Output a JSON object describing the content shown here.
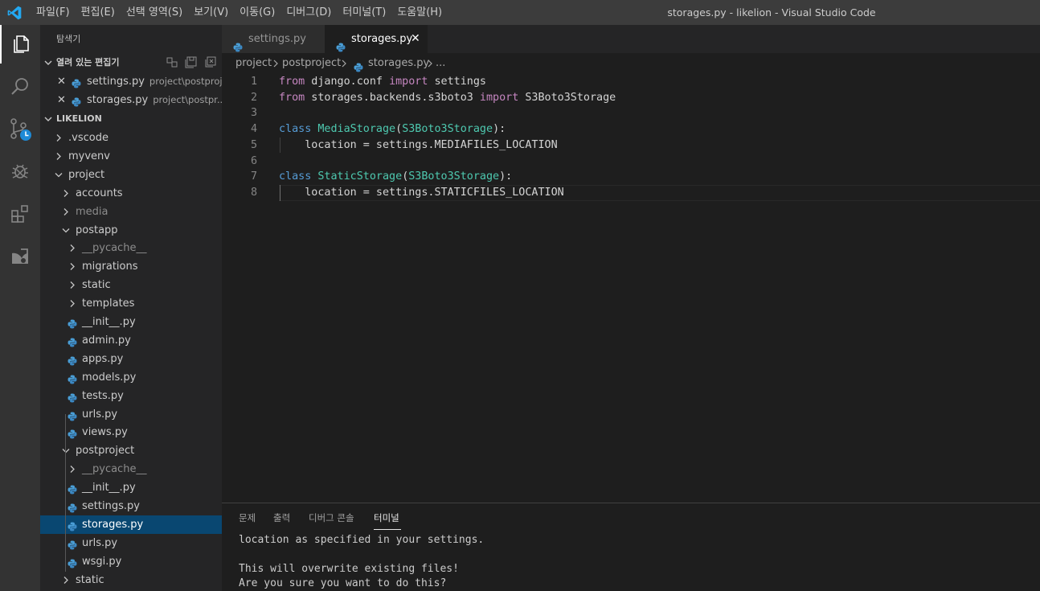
{
  "menu": [
    "파일(F)",
    "편집(E)",
    "선택 영역(S)",
    "보기(V)",
    "이동(G)",
    "디버그(D)",
    "터미널(T)",
    "도움말(H)"
  ],
  "window_title": "storages.py - likelion - Visual Studio Code",
  "activity_icons": [
    "explorer-icon",
    "search-icon",
    "source-control-icon",
    "debug-icon",
    "extensions-icon",
    "remote-icon"
  ],
  "sidebar": {
    "title": "탐색기",
    "open_editors_header": "열려 있는 편집기",
    "open_editors": [
      {
        "name": "settings.py",
        "path": "project\\postproj..."
      },
      {
        "name": "storages.py",
        "path": "project\\postpr..."
      }
    ],
    "workspace_header": "LIKELION",
    "tree": [
      {
        "label": "vscode_",
        "text": ".vscode",
        "kind": "folder",
        "state": "collapsed",
        "depth": 1
      },
      {
        "text": "myvenv",
        "kind": "folder",
        "state": "collapsed",
        "depth": 1
      },
      {
        "text": "project",
        "kind": "folder",
        "state": "expanded",
        "depth": 1
      },
      {
        "text": "accounts",
        "kind": "folder",
        "state": "collapsed",
        "depth": 2
      },
      {
        "text": "media",
        "kind": "folder",
        "state": "collapsed",
        "depth": 2,
        "dim": true
      },
      {
        "text": "postapp",
        "kind": "folder",
        "state": "expanded",
        "depth": 2
      },
      {
        "text": "__pycache__",
        "kind": "folder",
        "state": "collapsed",
        "depth": 3,
        "dim": true
      },
      {
        "text": "migrations",
        "kind": "folder",
        "state": "collapsed",
        "depth": 3
      },
      {
        "text": "static",
        "kind": "folder",
        "state": "collapsed",
        "depth": 3
      },
      {
        "text": "templates",
        "kind": "folder",
        "state": "collapsed",
        "depth": 3
      },
      {
        "text": "__init__.py",
        "kind": "py",
        "depth": 3
      },
      {
        "text": "admin.py",
        "kind": "py",
        "depth": 3
      },
      {
        "text": "apps.py",
        "kind": "py",
        "depth": 3
      },
      {
        "text": "models.py",
        "kind": "py",
        "depth": 3
      },
      {
        "text": "tests.py",
        "kind": "py",
        "depth": 3
      },
      {
        "text": "urls.py",
        "kind": "py",
        "depth": 3
      },
      {
        "text": "views.py",
        "kind": "py",
        "depth": 3
      },
      {
        "text": "postproject",
        "kind": "folder",
        "state": "expanded",
        "depth": 2
      },
      {
        "text": "__pycache__",
        "kind": "folder",
        "state": "collapsed",
        "depth": 3,
        "dim": true
      },
      {
        "text": "__init__.py",
        "kind": "py",
        "depth": 3
      },
      {
        "text": "settings.py",
        "kind": "py",
        "depth": 3
      },
      {
        "text": "storages.py",
        "kind": "py",
        "depth": 3,
        "selected": true
      },
      {
        "text": "urls.py",
        "kind": "py",
        "depth": 3
      },
      {
        "text": "wsgi.py",
        "kind": "py",
        "depth": 3
      },
      {
        "text": "static",
        "kind": "folder",
        "state": "collapsed",
        "depth": 2
      }
    ]
  },
  "tabs": [
    {
      "name": "settings.py",
      "active": false
    },
    {
      "name": "storages.py",
      "active": true
    }
  ],
  "breadcrumb": [
    "project",
    "postproject",
    "storages.py",
    "..."
  ],
  "code_lines": [
    {
      "n": "1",
      "tokens": [
        [
          "kw",
          "from"
        ],
        [
          "plain",
          " django.conf "
        ],
        [
          "kw",
          "import"
        ],
        [
          "plain",
          " settings"
        ]
      ]
    },
    {
      "n": "2",
      "tokens": [
        [
          "kw",
          "from"
        ],
        [
          "plain",
          " storages.backends.s3boto3 "
        ],
        [
          "kw",
          "import"
        ],
        [
          "plain",
          " S3Boto3Storage"
        ]
      ]
    },
    {
      "n": "3",
      "tokens": []
    },
    {
      "n": "4",
      "tokens": [
        [
          "kw2",
          "class"
        ],
        [
          "plain",
          " "
        ],
        [
          "cls",
          "MediaStorage"
        ],
        [
          "plain",
          "("
        ],
        [
          "cls",
          "S3Boto3Storage"
        ],
        [
          "plain",
          "):"
        ]
      ]
    },
    {
      "n": "5",
      "tokens": [
        [
          "plain",
          "    location = settings.MEDIAFILES_LOCATION"
        ]
      ]
    },
    {
      "n": "6",
      "tokens": []
    },
    {
      "n": "7",
      "tokens": [
        [
          "kw2",
          "class"
        ],
        [
          "plain",
          " "
        ],
        [
          "cls",
          "StaticStorage"
        ],
        [
          "plain",
          "("
        ],
        [
          "cls",
          "S3Boto3Storage"
        ],
        [
          "plain",
          "):"
        ]
      ]
    },
    {
      "n": "8",
      "tokens": [
        [
          "plain",
          "    location = settings.STATICFILES_LOCATION"
        ]
      ]
    }
  ],
  "panel": {
    "tabs": [
      "문제",
      "출력",
      "디버그 콘솔",
      "터미널"
    ],
    "active_tab": "터미널",
    "terminal_lines": [
      "location as specified in your settings.",
      "",
      "This will overwrite existing files!",
      "Are you sure you want to do this?"
    ]
  },
  "colors": {
    "selection": "#094771",
    "keyword": "#c586c0",
    "class_keyword": "#569cd6",
    "class_name": "#4ec9b0"
  }
}
